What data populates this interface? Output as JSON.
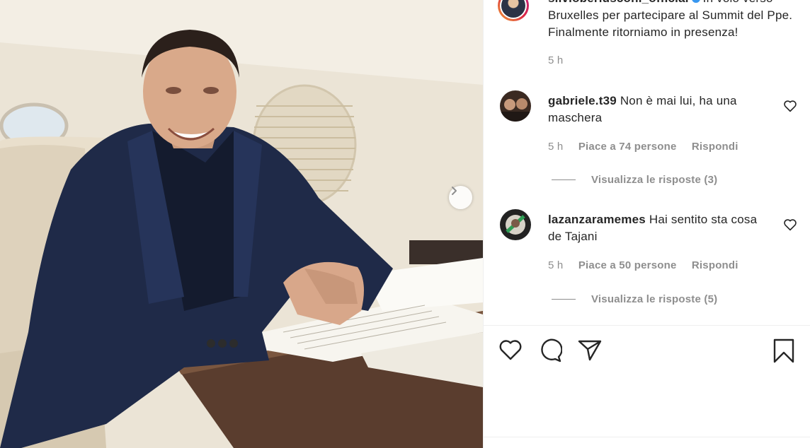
{
  "post": {
    "username": "silvioberlusconi_official",
    "caption": "In volo verso Bruxelles per partecipare al Summit del Ppe. Finalmente ritorniamo in presenza!",
    "caption_time": "5 h",
    "next_icon": "chevron-right-icon"
  },
  "comments": [
    {
      "username": "gabriele.t39",
      "text": "Non è mai lui, ha una maschera",
      "time": "5 h",
      "likes": "Piace a 74 persone",
      "reply": "Rispondi",
      "view_replies": "Visualizza le risposte (3)"
    },
    {
      "username": "lazanzaramemes",
      "text": "Hai sentito sta cosa de Tajani",
      "time": "5 h",
      "likes": "Piace a 50 persone",
      "reply": "Rispondi",
      "view_replies": "Visualizza le risposte (5)"
    }
  ],
  "actions": [
    "heart-icon",
    "comment-icon",
    "share-icon",
    "bookmark-icon"
  ],
  "colors": {
    "text": "#262626",
    "muted": "#8e8e8e",
    "verified": "#3897f0",
    "divider": "#efefef"
  }
}
